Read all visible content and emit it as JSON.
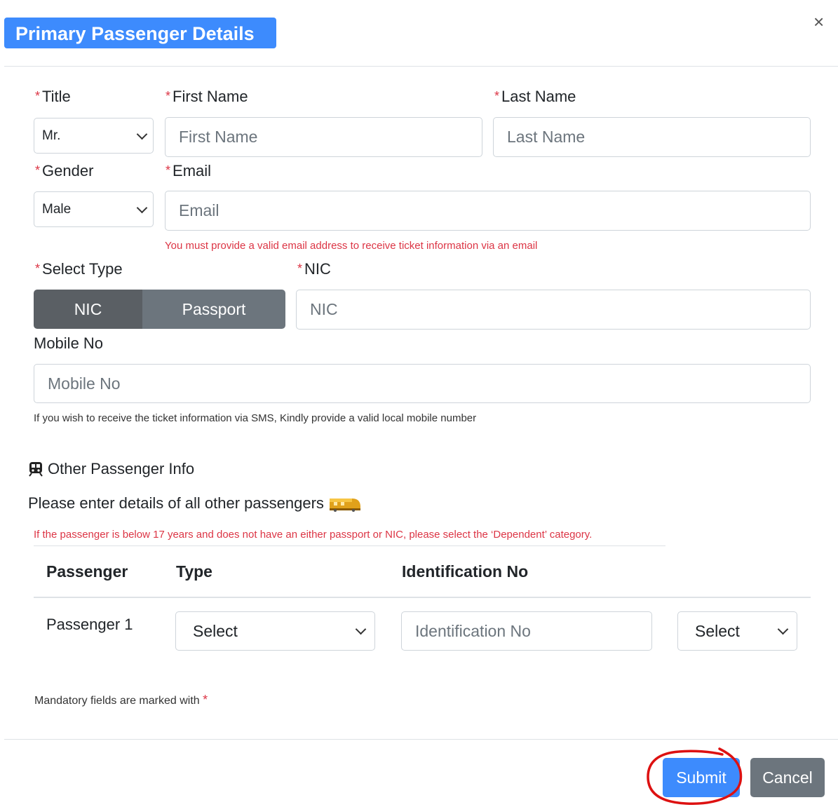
{
  "modal": {
    "title": "Primary Passenger Details",
    "close": "×"
  },
  "form": {
    "title_label": "Title",
    "title_value": "Mr.",
    "first_name_label": "First Name",
    "first_name_placeholder": "First Name",
    "last_name_label": "Last Name",
    "last_name_placeholder": "Last Name",
    "gender_label": "Gender",
    "gender_value": "Male",
    "email_label": "Email",
    "email_placeholder": "Email",
    "email_hint": "You must provide a valid email address to receive ticket information via an email",
    "select_type_label": "Select Type",
    "type_options": [
      "NIC",
      "Passport"
    ],
    "nic_label": "NIC",
    "nic_placeholder": "NIC",
    "mobile_label": "Mobile No",
    "mobile_placeholder": "Mobile No",
    "mobile_hint": "If you wish to receive the ticket information via SMS, Kindly provide a valid local mobile number",
    "required_mark": "*"
  },
  "other": {
    "heading": "Other Passenger Info",
    "instruction": "Please enter details of all other passengers",
    "note": "If the passenger is below 17 years and does not have an either passport or NIC, please select the ‘Dependent’ category.",
    "columns": [
      "Passenger",
      "Type",
      "Identification No"
    ],
    "rows": [
      {
        "passenger": "Passenger 1",
        "type_value": "Select",
        "id_placeholder": "Identification No",
        "extra_value": "Select"
      }
    ]
  },
  "footer": {
    "mandatory_text": "Mandatory fields are marked with",
    "mandatory_mark": "*",
    "submit": "Submit",
    "cancel": "Cancel"
  },
  "colors": {
    "primary": "#3d8bfd",
    "secondary": "#6c757d",
    "segment_active": "#5a5f64",
    "danger": "#dc3545",
    "annotation": "#dd1111"
  },
  "icons": {
    "train": "train-icon",
    "train_emoji": "train-emoji-icon",
    "close": "close-icon",
    "chevron": "chevron-down-icon"
  }
}
